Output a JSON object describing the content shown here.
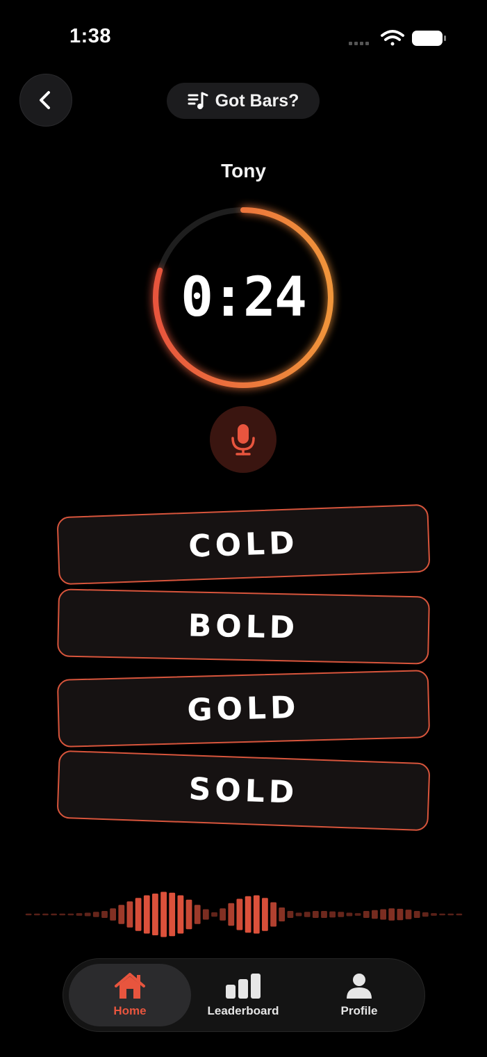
{
  "status_bar": {
    "time": "1:38"
  },
  "header": {
    "title": "Got Bars?",
    "title_icon": "music-list-icon",
    "back_icon": "chevron-left-icon"
  },
  "player": {
    "name": "Tony"
  },
  "timer": {
    "display": "0:24",
    "progress_fraction": 0.8
  },
  "mic": {
    "icon": "microphone-icon"
  },
  "words": [
    {
      "label": "COLD"
    },
    {
      "label": "BOLD"
    },
    {
      "label": "GOLD"
    },
    {
      "label": "SOLD"
    }
  ],
  "tabs": [
    {
      "label": "Home",
      "icon": "house-icon",
      "active": true
    },
    {
      "label": "Leaderboard",
      "icon": "bar-chart-icon",
      "active": false
    },
    {
      "label": "Profile",
      "icon": "person-icon",
      "active": false
    }
  ],
  "colors": {
    "accent": "#e8553e",
    "accent_orange": "#f08a3a",
    "background": "#000000"
  }
}
